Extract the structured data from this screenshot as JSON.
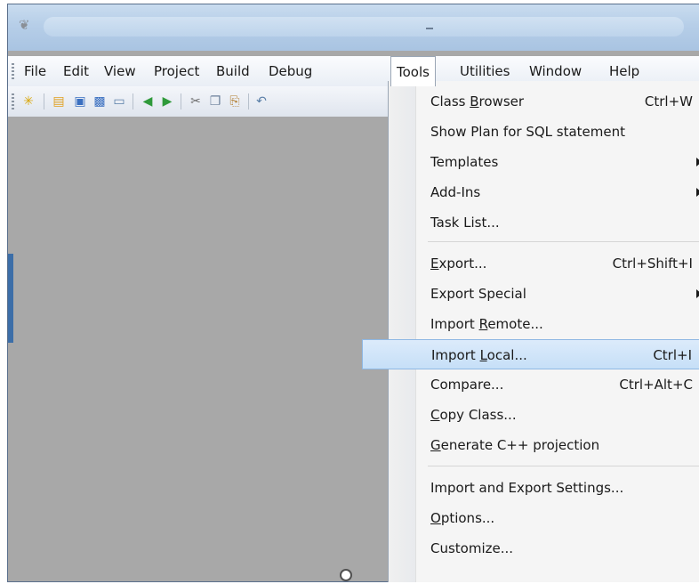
{
  "menubar": {
    "items": [
      "File",
      "Edit",
      "View",
      "Project",
      "Build",
      "Debug",
      "Tools",
      "Utilities",
      "Window",
      "Help"
    ],
    "active": "Tools"
  },
  "toolbar": {
    "icons": [
      "new-project-icon",
      "open-folder-icon",
      "save-icon",
      "save-all-icon",
      "print-icon",
      "back-icon",
      "forward-icon",
      "cut-icon",
      "copy-icon",
      "paste-icon",
      "undo-icon"
    ]
  },
  "tools_menu": {
    "items": [
      {
        "label": "Class Browser",
        "mnemonic": "B",
        "shortcut": "Ctrl+W",
        "submenu": false
      },
      {
        "label": "Show Plan for SQL statement",
        "shortcut": "",
        "submenu": false
      },
      {
        "label": "Templates",
        "shortcut": "",
        "submenu": true
      },
      {
        "label": "Add-Ins",
        "shortcut": "",
        "submenu": true
      },
      {
        "label": "Task List...",
        "shortcut": "",
        "submenu": false
      },
      {
        "label": "Export...",
        "mnemonic": "E",
        "shortcut": "Ctrl+Shift+I",
        "submenu": false
      },
      {
        "label": "Export Special",
        "shortcut": "",
        "submenu": true
      },
      {
        "label": "Import Remote...",
        "mnemonic": "R",
        "shortcut": "",
        "submenu": false
      },
      {
        "label": "Import Local...",
        "mnemonic": "L",
        "shortcut": "Ctrl+I",
        "submenu": false,
        "highlighted": true
      },
      {
        "label": "Compare...",
        "shortcut": "Ctrl+Alt+C",
        "submenu": false
      },
      {
        "label": "Copy Class...",
        "mnemonic": "C",
        "shortcut": "",
        "submenu": false
      },
      {
        "label": "Generate C++ projection",
        "mnemonic": "G",
        "shortcut": "",
        "submenu": false
      },
      {
        "label": "Import and Export Settings...",
        "shortcut": "",
        "submenu": false
      },
      {
        "label": "Options...",
        "mnemonic": "O",
        "shortcut": "",
        "submenu": false
      },
      {
        "label": "Customize...",
        "shortcut": "",
        "submenu": false
      }
    ]
  },
  "colors": {
    "highlight": "#c6dff7",
    "workspace": "#a8a8a8",
    "titlebar": "#b6cee8"
  }
}
